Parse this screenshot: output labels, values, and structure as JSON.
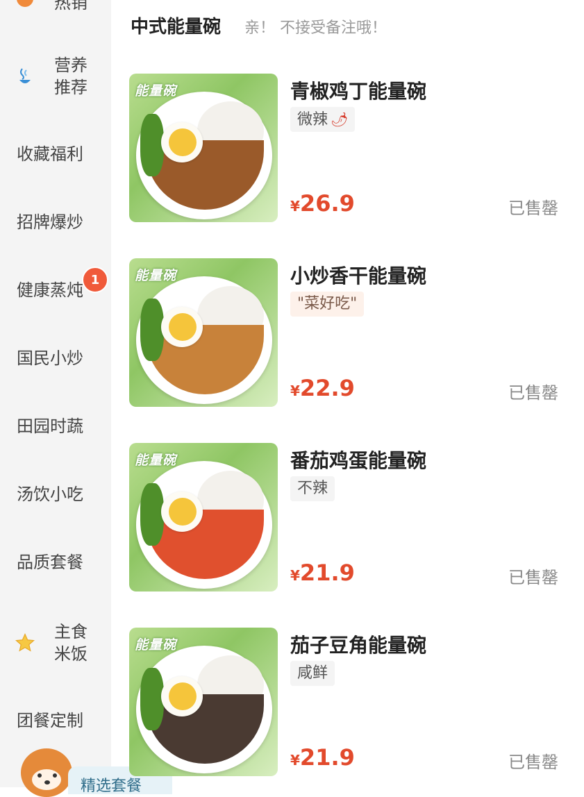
{
  "sidebar": {
    "top_partial": "热销",
    "categories": [
      {
        "label": "营养推荐",
        "line1": "营养",
        "line2": "推荐",
        "icon": "steam-bowl-icon"
      },
      {
        "label": "收藏福利"
      },
      {
        "label": "招牌爆炒"
      },
      {
        "label": "健康蒸炖",
        "badge": "1"
      },
      {
        "label": "国民小炒"
      },
      {
        "label": "田园时蔬"
      },
      {
        "label": "汤饮小吃"
      },
      {
        "label": "品质套餐"
      },
      {
        "label": "主食米饭",
        "line1": "主食",
        "line2": "米饭",
        "icon": "star-icon"
      },
      {
        "label": "团餐定制"
      }
    ],
    "bottom_bubble": "精选套餐"
  },
  "section": {
    "title": "中式能量碗",
    "note": "亲！ 不接受备注哦！"
  },
  "products": [
    {
      "name": "青椒鸡丁能量碗",
      "tag": "微辣",
      "tag_icon": "chili-icon",
      "price_symbol": "¥",
      "price": "26.9",
      "status": "已售罄",
      "image_label": "能量碗",
      "mix_color": "#9a5a2a"
    },
    {
      "name": "小炒香干能量碗",
      "tag": "\"菜好吃\"",
      "price_symbol": "¥",
      "price": "22.9",
      "status": "已售罄",
      "image_label": "能量碗",
      "mix_color": "#c8823a"
    },
    {
      "name": "番茄鸡蛋能量碗",
      "tag": "不辣",
      "price_symbol": "¥",
      "price": "21.9",
      "status": "已售罄",
      "image_label": "能量碗",
      "mix_color": "#e0502e"
    },
    {
      "name": "茄子豆角能量碗",
      "tag": "咸鲜",
      "price_symbol": "¥",
      "price": "21.9",
      "status": "已售罄",
      "image_label": "能量碗",
      "mix_color": "#4a3a32"
    }
  ],
  "colors": {
    "price": "#e24a2c",
    "badge": "#f05a3a",
    "sidebar_bg": "#f4f4f4"
  }
}
